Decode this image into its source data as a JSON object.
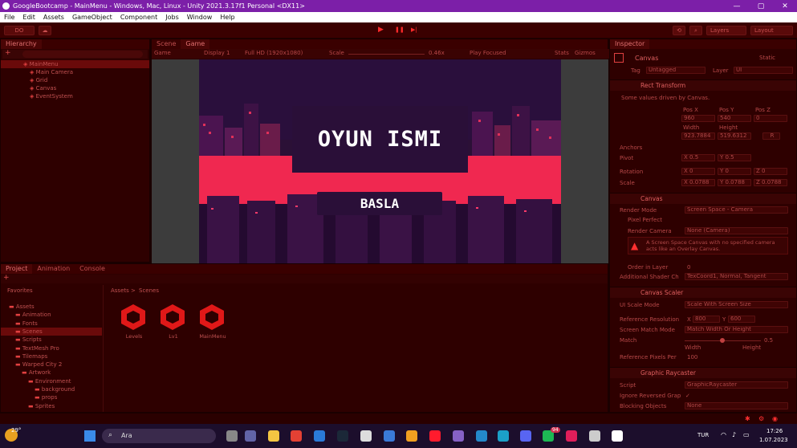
{
  "window": {
    "title": "GoogleBootcamp - MainMenu - Windows, Mac, Linux - Unity 2021.3.17f1 Personal <DX11>",
    "min": "—",
    "max": "▢",
    "close": "✕"
  },
  "menu": [
    "File",
    "Edit",
    "Assets",
    "GameObject",
    "Component",
    "Jobs",
    "Window",
    "Help"
  ],
  "toolbar": {
    "account": "DO",
    "layers": "Layers",
    "layout": "Layout",
    "play": "▶",
    "pause": "❚❚",
    "step": "▶|"
  },
  "hierarchy": {
    "tab": "Hierarchy",
    "items": [
      {
        "label": "MainMenu",
        "indent": 0,
        "selected": true
      },
      {
        "label": "Main Camera",
        "indent": 1
      },
      {
        "label": "Grid",
        "indent": 1
      },
      {
        "label": "Canvas",
        "indent": 1
      },
      {
        "label": "EventSystem",
        "indent": 1
      }
    ]
  },
  "game": {
    "tab_scene": "Scene",
    "tab_game": "Game",
    "display_mode": "Game",
    "display": "Display 1",
    "resolution": "Full HD (1920x1080)",
    "scale_label": "Scale",
    "scale_value": "0.46x",
    "play_focused": "Play Focused",
    "stats": "Stats",
    "gizmos": "Gizmos",
    "title_text": "OYUN ISMI",
    "button_text": "BASLA"
  },
  "project": {
    "tabs": [
      "Project",
      "Animation",
      "Console"
    ],
    "favorites": "Favorites",
    "breadcrumb_root": "Assets",
    "breadcrumb_sep": ">",
    "breadcrumb_leaf": "Scenes",
    "tree": [
      {
        "label": "Assets",
        "indent": 0
      },
      {
        "label": "Animation",
        "indent": 1
      },
      {
        "label": "Fonts",
        "indent": 1
      },
      {
        "label": "Scenes",
        "indent": 1,
        "selected": true
      },
      {
        "label": "Scripts",
        "indent": 1
      },
      {
        "label": "TextMesh Pro",
        "indent": 1
      },
      {
        "label": "Tilemaps",
        "indent": 1
      },
      {
        "label": "Warped City 2",
        "indent": 1
      },
      {
        "label": "Artwork",
        "indent": 2
      },
      {
        "label": "Environment",
        "indent": 3
      },
      {
        "label": "background",
        "indent": 4
      },
      {
        "label": "props",
        "indent": 4
      },
      {
        "label": "Sprites",
        "indent": 3
      }
    ],
    "files": [
      "Levels",
      "Lv1",
      "MainMenu"
    ]
  },
  "inspector": {
    "tab": "Inspector",
    "object_name": "Canvas",
    "static": "Static",
    "tag_label": "Tag",
    "tag_value": "Untagged",
    "layer_label": "Layer",
    "layer_value": "UI",
    "rect": {
      "header": "Rect Transform",
      "note": "Some values driven by Canvas.",
      "posx": "Pos X",
      "posy": "Pos Y",
      "posz": "Pos Z",
      "vx": "960",
      "vy": "540",
      "vz": "0",
      "width": "Width",
      "height": "Height",
      "w": "923.7884",
      "h": "519.6312",
      "r": "R",
      "anchors": "Anchors",
      "pivot": "Pivot",
      "pivot_x": "X 0.5",
      "pivot_y": "Y 0.5",
      "rotation": "Rotation",
      "rot_x": "X 0",
      "rot_y": "Y 0",
      "rot_z": "Z 0",
      "scale": "Scale",
      "scale_x": "X 0.0788",
      "scale_y": "Y 0.0788",
      "scale_z": "Z 0.0788"
    },
    "canvas": {
      "header": "Canvas",
      "render_mode_label": "Render Mode",
      "render_mode": "Screen Space - Camera",
      "pixel_perfect": "Pixel Perfect",
      "render_camera_label": "Render Camera",
      "render_camera": "None (Camera)",
      "warning": "A Screen Space Canvas with no specified camera acts like an Overlay Canvas.",
      "order_label": "Order in Layer",
      "order": "0",
      "shader_label": "Additional Shader Ch",
      "shader": "TexCoord1, Normal, Tangent"
    },
    "scaler": {
      "header": "Canvas Scaler",
      "mode_label": "UI Scale Mode",
      "mode": "Scale With Screen Size",
      "ref_label": "Reference Resolution",
      "ref_x": "X",
      "ref_xv": "800",
      "ref_y": "Y",
      "ref_yv": "600",
      "match_mode_label": "Screen Match Mode",
      "match_mode": "Match Width Or Height",
      "match_label": "Match",
      "match_value": "0.5",
      "width": "Width",
      "height": "Height",
      "ppu_label": "Reference Pixels Per",
      "ppu": "100"
    },
    "raycaster": {
      "header": "Graphic Raycaster",
      "script_label": "Script",
      "script": "GraphicRaycaster",
      "ignore_label": "Ignore Reversed Grap",
      "ignore": "✓",
      "blocking_label": "Blocking Objects",
      "blocking": "None"
    }
  },
  "taskbar": {
    "weather": "29°",
    "search": "Ara",
    "lang": "TUR",
    "time": "17:26",
    "date": "1.07.2023",
    "badge": "94"
  }
}
